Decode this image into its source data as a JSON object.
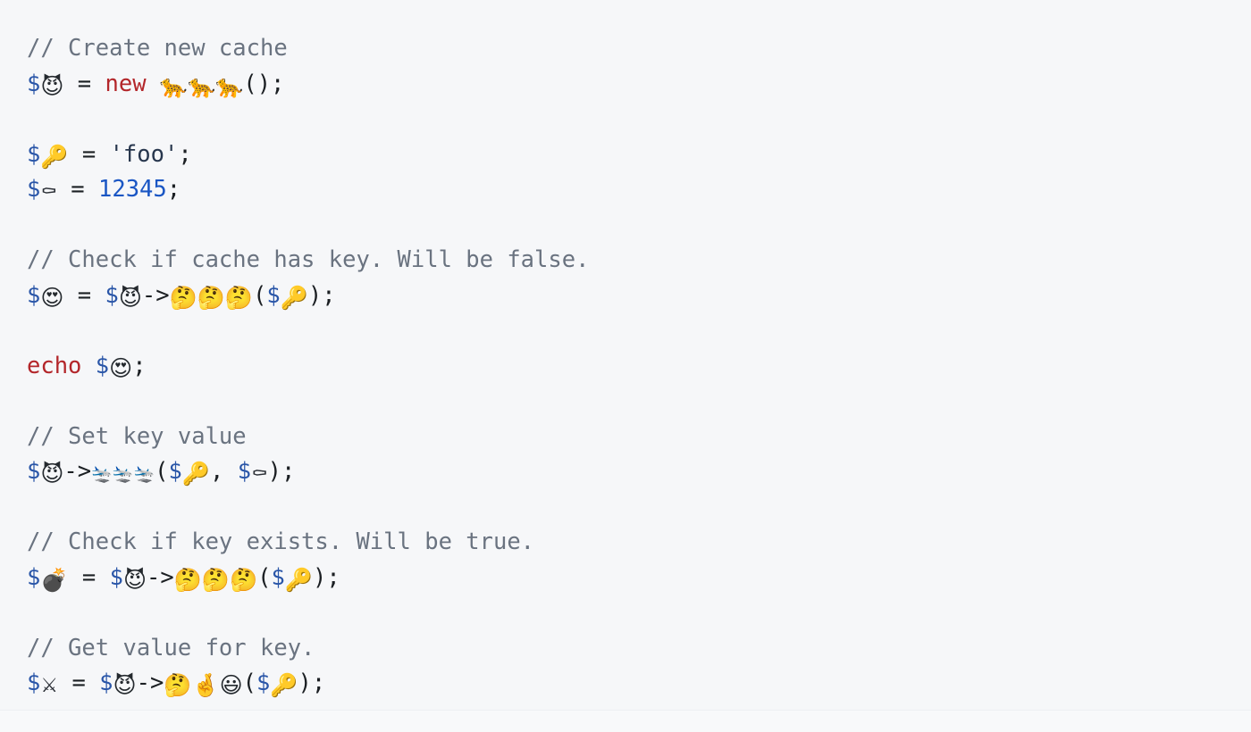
{
  "block": {
    "language": "php",
    "background_color": "#f6f7f9",
    "colors": {
      "comment": "#6a7380",
      "keyword": "#b3262a",
      "variable_sigil": "#2a56a8",
      "number": "#1a56c4",
      "string": "#27364d",
      "punctuation": "#1b1f23",
      "divider": "#edeff2"
    }
  },
  "lines": [
    {
      "index": 1,
      "type": "comment",
      "text": "// Create new cache",
      "tokens": [
        {
          "kind": "comment",
          "text": "// Create new cache"
        }
      ]
    },
    {
      "index": 2,
      "type": "code",
      "text": "$😈 = new 🐆🐆🐆();",
      "tokens": [
        {
          "kind": "var",
          "text": "$"
        },
        {
          "kind": "emoji",
          "text": "😈",
          "name": "smiling-face-with-horns-emoji"
        },
        {
          "kind": "plain",
          "text": " "
        },
        {
          "kind": "op",
          "text": "="
        },
        {
          "kind": "plain",
          "text": " "
        },
        {
          "kind": "keyword",
          "text": "new"
        },
        {
          "kind": "plain",
          "text": " "
        },
        {
          "kind": "emoji",
          "text": "🐆",
          "name": "leopard-emoji"
        },
        {
          "kind": "emoji",
          "text": "🐆",
          "name": "leopard-emoji"
        },
        {
          "kind": "emoji",
          "text": "🐆",
          "name": "leopard-emoji"
        },
        {
          "kind": "punct",
          "text": "();"
        }
      ]
    },
    {
      "index": 3,
      "type": "blank",
      "text": "",
      "tokens": []
    },
    {
      "index": 4,
      "type": "code",
      "text": "$🔑 = 'foo';",
      "tokens": [
        {
          "kind": "var",
          "text": "$"
        },
        {
          "kind": "emoji",
          "text": "🔑",
          "name": "key-emoji"
        },
        {
          "kind": "plain",
          "text": " "
        },
        {
          "kind": "op",
          "text": "="
        },
        {
          "kind": "plain",
          "text": " "
        },
        {
          "kind": "string",
          "text": "'foo'"
        },
        {
          "kind": "punct",
          "text": ";"
        }
      ]
    },
    {
      "index": 5,
      "type": "code",
      "text": "$⚰ = 12345;",
      "tokens": [
        {
          "kind": "var",
          "text": "$"
        },
        {
          "kind": "emoji-mono",
          "text": "⚰",
          "name": "coffin-emoji"
        },
        {
          "kind": "plain",
          "text": " "
        },
        {
          "kind": "op",
          "text": "="
        },
        {
          "kind": "plain",
          "text": " "
        },
        {
          "kind": "number",
          "text": "12345"
        },
        {
          "kind": "punct",
          "text": ";"
        }
      ]
    },
    {
      "index": 6,
      "type": "blank",
      "text": "",
      "tokens": []
    },
    {
      "index": 7,
      "type": "comment",
      "text": "// Check if cache has key. Will be false.",
      "tokens": [
        {
          "kind": "comment",
          "text": "// Check if cache has key. Will be false."
        }
      ]
    },
    {
      "index": 8,
      "type": "code",
      "text": "$😍 = $😈->🤔🤔🤔($🔑);",
      "tokens": [
        {
          "kind": "var",
          "text": "$"
        },
        {
          "kind": "emoji",
          "text": "😍",
          "name": "smiling-face-with-heart-eyes-emoji"
        },
        {
          "kind": "plain",
          "text": " "
        },
        {
          "kind": "op",
          "text": "="
        },
        {
          "kind": "plain",
          "text": " "
        },
        {
          "kind": "var",
          "text": "$"
        },
        {
          "kind": "emoji",
          "text": "😈",
          "name": "smiling-face-with-horns-emoji"
        },
        {
          "kind": "op",
          "text": "->"
        },
        {
          "kind": "emoji",
          "text": "🤔",
          "name": "thinking-face-emoji"
        },
        {
          "kind": "emoji",
          "text": "🤔",
          "name": "thinking-face-emoji"
        },
        {
          "kind": "emoji",
          "text": "🤔",
          "name": "thinking-face-emoji"
        },
        {
          "kind": "punct",
          "text": "("
        },
        {
          "kind": "var",
          "text": "$"
        },
        {
          "kind": "emoji",
          "text": "🔑",
          "name": "key-emoji"
        },
        {
          "kind": "punct",
          "text": ");"
        }
      ]
    },
    {
      "index": 9,
      "type": "blank",
      "text": "",
      "tokens": []
    },
    {
      "index": 10,
      "type": "code",
      "text": "echo $😍;",
      "tokens": [
        {
          "kind": "keyword",
          "text": "echo"
        },
        {
          "kind": "plain",
          "text": " "
        },
        {
          "kind": "var",
          "text": "$"
        },
        {
          "kind": "emoji",
          "text": "😍",
          "name": "smiling-face-with-heart-eyes-emoji"
        },
        {
          "kind": "punct",
          "text": ";"
        }
      ]
    },
    {
      "index": 11,
      "type": "blank",
      "text": "",
      "tokens": []
    },
    {
      "index": 12,
      "type": "comment",
      "text": "// Set key value",
      "tokens": [
        {
          "kind": "comment",
          "text": "// Set key value"
        }
      ]
    },
    {
      "index": 13,
      "type": "code",
      "text": "$😈->🛬🛬🛬($🔑, $⚰);",
      "tokens": [
        {
          "kind": "var",
          "text": "$"
        },
        {
          "kind": "emoji",
          "text": "😈",
          "name": "smiling-face-with-horns-emoji"
        },
        {
          "kind": "op",
          "text": "->"
        },
        {
          "kind": "emoji-mono-small",
          "text": "🛬",
          "name": "mailbox-with-raised-flag-emoji"
        },
        {
          "kind": "emoji-mono-small",
          "text": "🛬",
          "name": "mailbox-with-raised-flag-emoji"
        },
        {
          "kind": "emoji-mono-small",
          "text": "🛬",
          "name": "mailbox-with-raised-flag-emoji"
        },
        {
          "kind": "punct",
          "text": "("
        },
        {
          "kind": "var",
          "text": "$"
        },
        {
          "kind": "emoji",
          "text": "🔑",
          "name": "key-emoji"
        },
        {
          "kind": "punct",
          "text": ","
        },
        {
          "kind": "plain",
          "text": " "
        },
        {
          "kind": "var",
          "text": "$"
        },
        {
          "kind": "emoji-mono",
          "text": "⚰",
          "name": "coffin-emoji"
        },
        {
          "kind": "punct",
          "text": ");"
        }
      ]
    },
    {
      "index": 14,
      "type": "blank",
      "text": "",
      "tokens": []
    },
    {
      "index": 15,
      "type": "comment",
      "text": "// Check if key exists. Will be true.",
      "tokens": [
        {
          "kind": "comment",
          "text": "// Check if key exists. Will be true."
        }
      ]
    },
    {
      "index": 16,
      "type": "code",
      "text": "$💣 = $😈->🤔🤔🤔($🔑);",
      "tokens": [
        {
          "kind": "var",
          "text": "$"
        },
        {
          "kind": "emoji",
          "text": "💣",
          "name": "bomb-emoji"
        },
        {
          "kind": "plain",
          "text": " "
        },
        {
          "kind": "op",
          "text": "="
        },
        {
          "kind": "plain",
          "text": " "
        },
        {
          "kind": "var",
          "text": "$"
        },
        {
          "kind": "emoji",
          "text": "😈",
          "name": "smiling-face-with-horns-emoji"
        },
        {
          "kind": "op",
          "text": "->"
        },
        {
          "kind": "emoji",
          "text": "🤔",
          "name": "thinking-face-emoji"
        },
        {
          "kind": "emoji",
          "text": "🤔",
          "name": "thinking-face-emoji"
        },
        {
          "kind": "emoji",
          "text": "🤔",
          "name": "thinking-face-emoji"
        },
        {
          "kind": "punct",
          "text": "("
        },
        {
          "kind": "var",
          "text": "$"
        },
        {
          "kind": "emoji",
          "text": "🔑",
          "name": "key-emoji"
        },
        {
          "kind": "punct",
          "text": ");"
        }
      ]
    },
    {
      "index": 17,
      "type": "blank",
      "text": "",
      "tokens": []
    },
    {
      "index": 18,
      "type": "comment",
      "text": "// Get value for key.",
      "tokens": [
        {
          "kind": "comment",
          "text": "// Get value for key."
        }
      ]
    },
    {
      "index": 19,
      "type": "code",
      "text": "$⚔ = $😈->🤔🤞😃($🔑);",
      "tokens": [
        {
          "kind": "var",
          "text": "$"
        },
        {
          "kind": "emoji-mono",
          "text": "⚔",
          "name": "crossed-swords-emoji"
        },
        {
          "kind": "plain",
          "text": " "
        },
        {
          "kind": "op",
          "text": "="
        },
        {
          "kind": "plain",
          "text": " "
        },
        {
          "kind": "var",
          "text": "$"
        },
        {
          "kind": "emoji",
          "text": "😈",
          "name": "smiling-face-with-horns-emoji"
        },
        {
          "kind": "op",
          "text": "->"
        },
        {
          "kind": "emoji",
          "text": "🤔",
          "name": "thinking-face-emoji"
        },
        {
          "kind": "emoji",
          "text": "🤞",
          "name": "crossed-fingers-emoji"
        },
        {
          "kind": "emoji",
          "text": "😃",
          "name": "grinning-face-with-big-eyes-emoji"
        },
        {
          "kind": "punct",
          "text": "("
        },
        {
          "kind": "var",
          "text": "$"
        },
        {
          "kind": "emoji",
          "text": "🔑",
          "name": "key-emoji"
        },
        {
          "kind": "punct",
          "text": ");"
        }
      ]
    }
  ]
}
